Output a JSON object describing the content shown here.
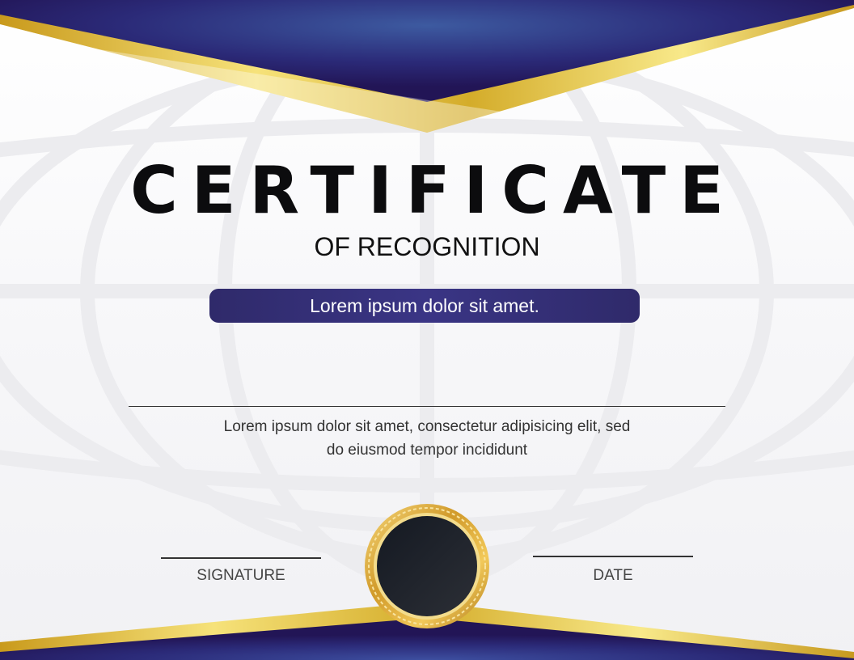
{
  "certificate": {
    "title": "CERTIFICATE",
    "subtitle": "OF RECOGNITION",
    "recipient_name": "Lorem ipsum dolor sit amet.",
    "description_line1": "Lorem ipsum dolor sit amet, consectetur adipisicing elit, sed",
    "description_line2": "do eiusmod tempor incididunt",
    "signature_label": "SIGNATURE",
    "date_label": "DATE"
  },
  "colors": {
    "navy": "#2f2a6a",
    "navy_dark": "#22175a",
    "gold": "#e3c234",
    "seal_core": "#1a1d24",
    "text_dark": "#0c0c0e"
  },
  "icons": {
    "background": "globe-pattern",
    "seal": "award-seal"
  }
}
